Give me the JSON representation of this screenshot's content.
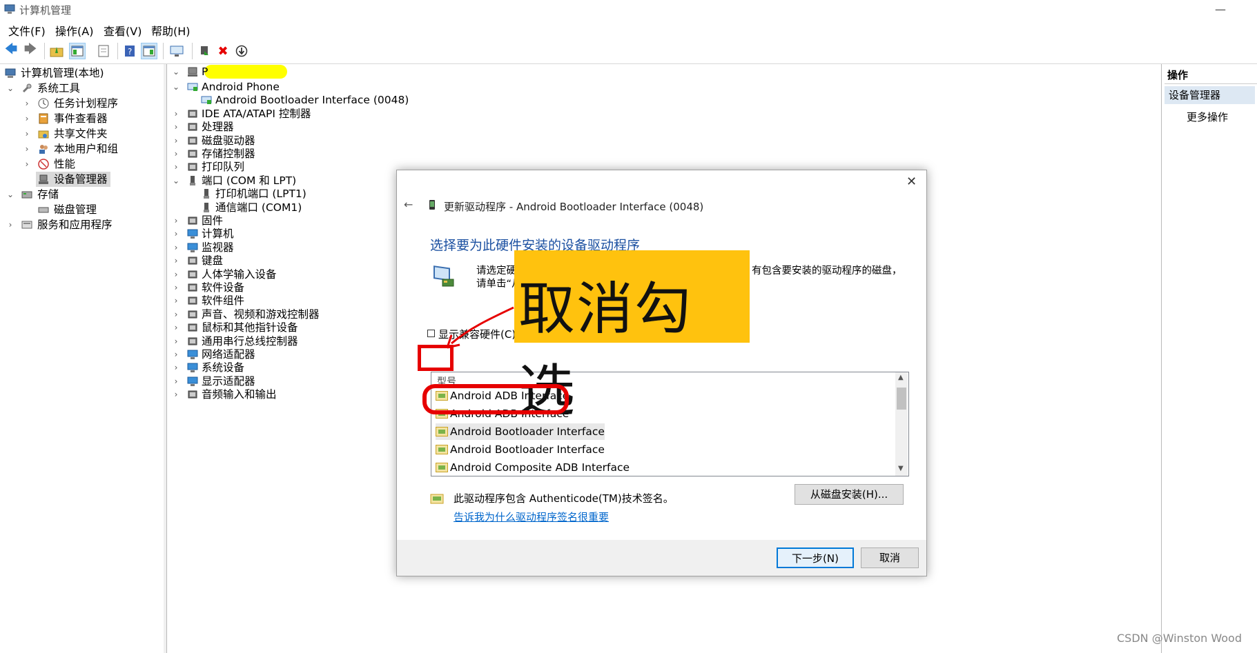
{
  "window": {
    "title": "计算机管理",
    "minimize": "—"
  },
  "menu": [
    "文件(F)",
    "操作(A)",
    "查看(V)",
    "帮助(H)"
  ],
  "left_tree": {
    "root": "计算机管理(本地)",
    "system_tools": "系统工具",
    "task_scheduler": "任务计划程序",
    "event_viewer": "事件查看器",
    "shared_folders": "共享文件夹",
    "local_users": "本地用户和组",
    "performance": "性能",
    "device_manager": "设备管理器",
    "storage": "存储",
    "disk_management": "磁盘管理",
    "services_apps": "服务和应用程序"
  },
  "device_tree": {
    "root": "P",
    "items": [
      {
        "label": "Android Phone",
        "expanded": true
      },
      {
        "label": "Android Bootloader Interface (0048)",
        "child": true
      },
      {
        "label": "IDE ATA/ATAPI 控制器"
      },
      {
        "label": "处理器"
      },
      {
        "label": "磁盘驱动器"
      },
      {
        "label": "存储控制器"
      },
      {
        "label": "打印队列"
      },
      {
        "label": "端口 (COM 和 LPT)",
        "expanded": true
      },
      {
        "label": "打印机端口 (LPT1)",
        "child": true
      },
      {
        "label": "通信端口 (COM1)",
        "child": true
      },
      {
        "label": "固件"
      },
      {
        "label": "计算机"
      },
      {
        "label": "监视器"
      },
      {
        "label": "键盘"
      },
      {
        "label": "人体学输入设备"
      },
      {
        "label": "软件设备"
      },
      {
        "label": "软件组件"
      },
      {
        "label": "声音、视频和游戏控制器"
      },
      {
        "label": "鼠标和其他指针设备"
      },
      {
        "label": "通用串行总线控制器"
      },
      {
        "label": "网络适配器"
      },
      {
        "label": "系统设备"
      },
      {
        "label": "显示适配器"
      },
      {
        "label": "音频输入和输出"
      }
    ]
  },
  "actions": {
    "header": "操作",
    "section": "设备管理器",
    "more": "更多操作"
  },
  "dialog": {
    "title": "更新驱动程序 - Android Bootloader Interface (0048)",
    "heading": "选择要为此硬件安装的设备驱动程序",
    "instruction_line1": "请选定硬",
    "instruction_line1_tail": "有包含要安装的驱动程序的磁盘，",
    "instruction_line2": "请单击“从",
    "show_compatible": "显示兼容硬件(C)",
    "list_header": "型号",
    "models": [
      "Android ADB Interface",
      "Android ADB Interface",
      "Android Bootloader Interface",
      "Android Bootloader Interface",
      "Android Composite ADB Interface"
    ],
    "signed_text": "此驱动程序包含 Authenticode(TM)技术签名。",
    "signing_link": "告诉我为什么驱动程序签名很重要",
    "have_disk": "从磁盘安装(H)...",
    "next": "下一步(N)",
    "cancel": "取消",
    "close": "✕",
    "back": "←"
  },
  "annotation": {
    "callout": "取消勾选"
  },
  "watermark": "CSDN @Winston Wood",
  "colors": {
    "annotation_red": "#e60000",
    "callout_yellow": "#ffc20e",
    "link_blue": "#0066cc",
    "heading_blue": "#1a4fa0"
  }
}
